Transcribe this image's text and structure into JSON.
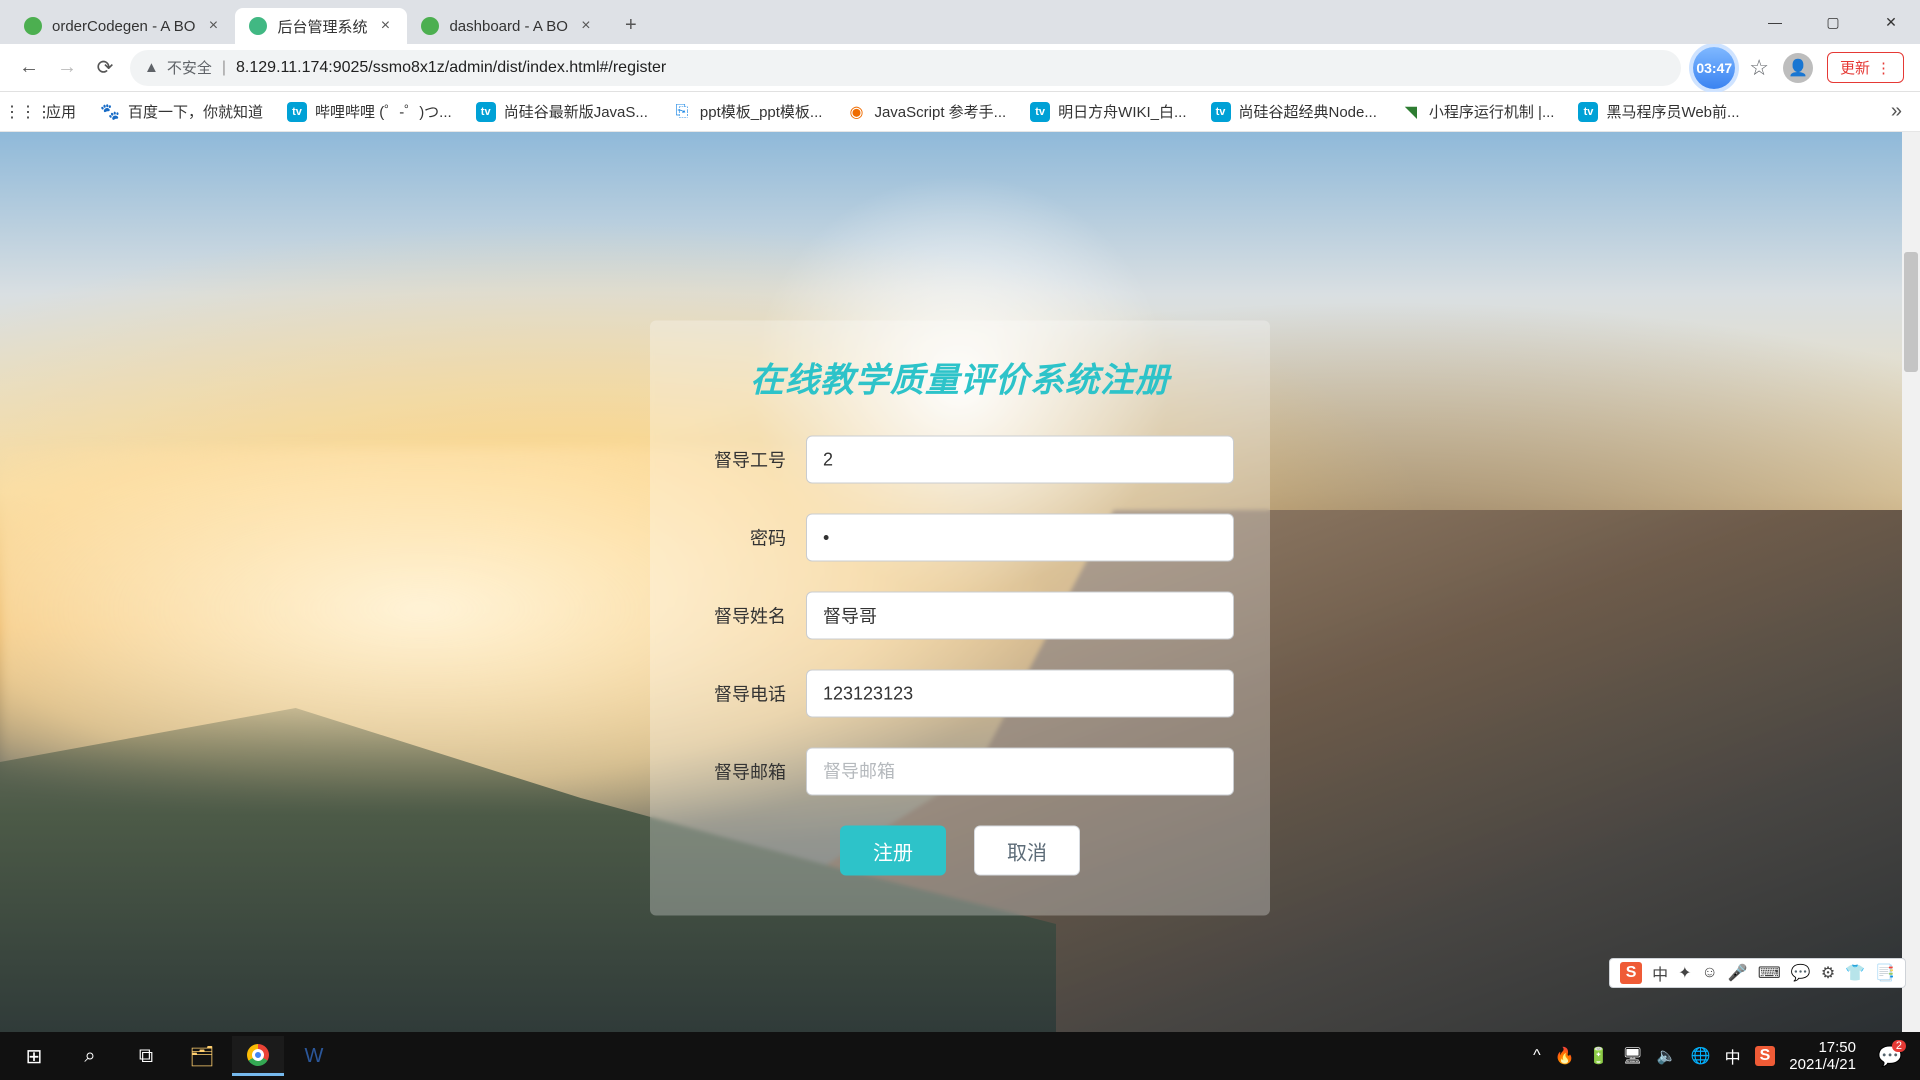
{
  "browser": {
    "tabs": [
      {
        "title": "orderCodegen - A BO",
        "fav_color": "#4caf50"
      },
      {
        "title": "后台管理系统",
        "fav_color": "#41b883"
      },
      {
        "title": "dashboard - A BO",
        "fav_color": "#4caf50"
      }
    ],
    "active_tab_index": 1,
    "url_insecure_label": "不安全",
    "url": "8.129.11.174:9025/ssmo8x1z/admin/dist/index.html#/register",
    "blue_badge": "03:47",
    "update_label": "更新",
    "bookmarks_app": "应用",
    "bookmarks": [
      {
        "label": "百度一下，你就知道",
        "icon": "🐾"
      },
      {
        "label": "哔哩哔哩 (゜-゜)つ...",
        "icon": "bili"
      },
      {
        "label": "尚硅谷最新版JavaS...",
        "icon": "bili"
      },
      {
        "label": "ppt模板_ppt模板...",
        "icon": "📄"
      },
      {
        "label": "JavaScript 参考手...",
        "icon": "🟧"
      },
      {
        "label": "明日方舟WIKI_白...",
        "icon": "bili"
      },
      {
        "label": "尚硅谷超经典Node...",
        "icon": "bili"
      },
      {
        "label": "小程序运行机制 |...",
        "icon": "🟩"
      },
      {
        "label": "黑马程序员Web前...",
        "icon": "bili"
      }
    ]
  },
  "form": {
    "title": "在线教学质量评价系统注册",
    "fields": {
      "id": {
        "label": "督导工号",
        "value": "2",
        "placeholder": ""
      },
      "pwd": {
        "label": "密码",
        "value": "•",
        "placeholder": ""
      },
      "name": {
        "label": "督导姓名",
        "value": "督导哥",
        "placeholder": ""
      },
      "phone": {
        "label": "督导电话",
        "value": "123123123",
        "placeholder": ""
      },
      "email": {
        "label": "督导邮箱",
        "value": "",
        "placeholder": "督导邮箱"
      }
    },
    "submit_label": "注册",
    "cancel_label": "取消"
  },
  "ime": {
    "logo": "S",
    "items": [
      "中",
      "✦",
      "☺",
      "🎤",
      "⌨",
      "💬",
      "⚙",
      "👕",
      "📑"
    ]
  },
  "taskbar": {
    "time": "17:50",
    "date": "2021/4/21",
    "tray": [
      "^",
      "🔥",
      "🔋",
      "🖥",
      "🔈",
      "🌐",
      "中"
    ],
    "sogou": "S",
    "notif_badge": "2"
  }
}
